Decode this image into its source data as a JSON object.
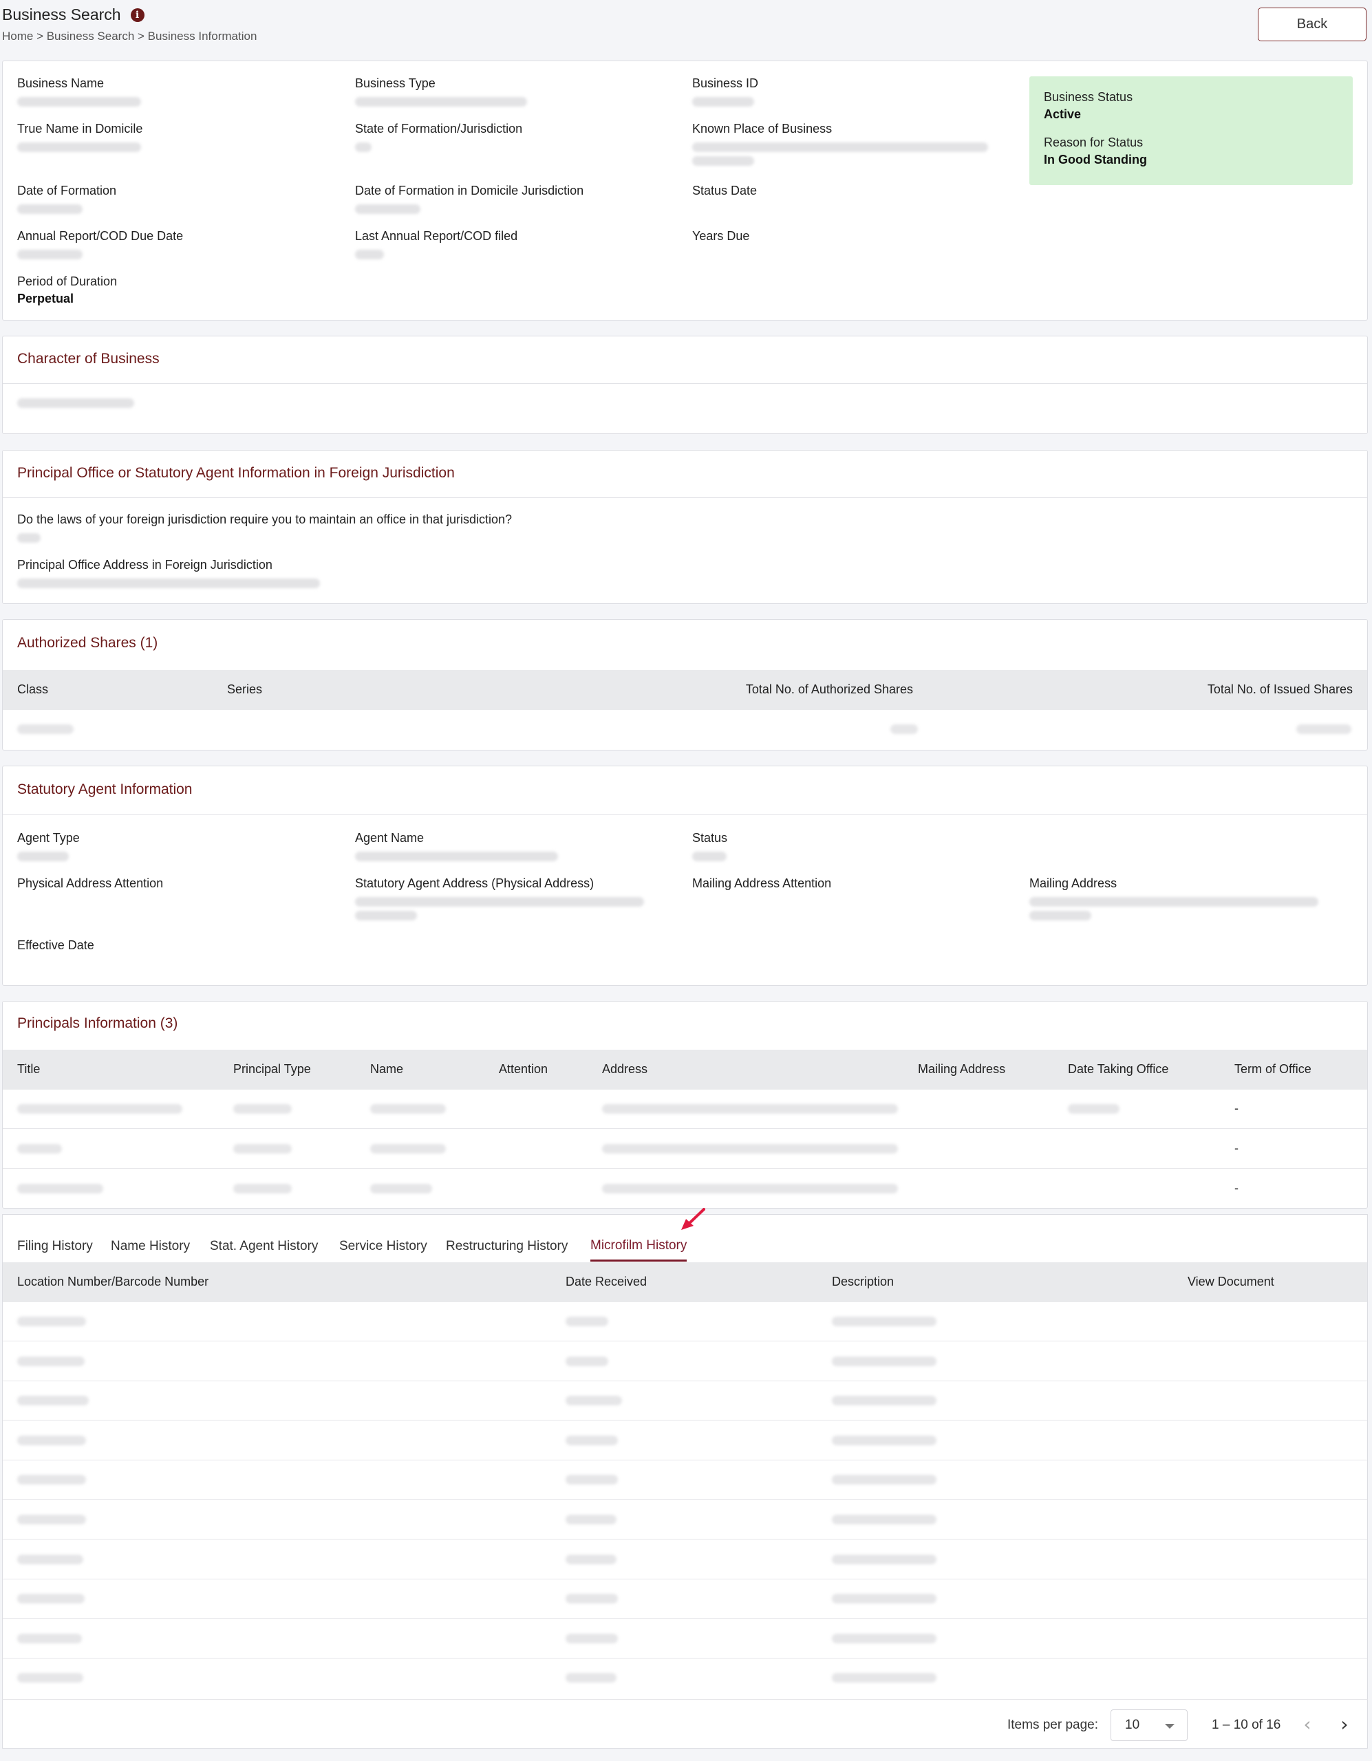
{
  "header": {
    "title": "Business Search",
    "breadcrumb": "Home > Business Search > Business Information",
    "back_label": "Back"
  },
  "details": {
    "business_name_label": "Business Name",
    "business_type_label": "Business Type",
    "business_id_label": "Business ID",
    "true_name_label": "True Name in Domicile",
    "state_formation_label": "State of Formation/Jurisdiction",
    "known_place_label": "Known Place of Business",
    "date_formation_label": "Date of Formation",
    "date_formation_domicile_label": "Date of Formation in Domicile Jurisdiction",
    "status_date_label": "Status Date",
    "annual_report_due_label": "Annual Report/COD Due Date",
    "last_annual_report_label": "Last Annual Report/COD filed",
    "years_due_label": "Years Due",
    "period_duration_label": "Period of Duration",
    "period_duration_value": "Perpetual",
    "status_label": "Business Status",
    "status_value": "Active",
    "reason_label": "Reason for Status",
    "reason_value": "In Good Standing"
  },
  "character": {
    "title": "Character of Business"
  },
  "principal_office": {
    "title": "Principal Office or Statutory Agent Information in Foreign Jurisdiction",
    "question_label": "Do the laws of your foreign jurisdiction require you to maintain an office in that jurisdiction?",
    "address_label": "Principal Office Address in Foreign Jurisdiction"
  },
  "shares": {
    "title": "Authorized Shares (1)",
    "columns": [
      "Class",
      "Series",
      "Total No. of Authorized Shares",
      "Total No. of Issued Shares"
    ]
  },
  "agent": {
    "title": "Statutory Agent Information",
    "agent_type_label": "Agent Type",
    "agent_name_label": "Agent Name",
    "status_label": "Status",
    "physical_attention_label": "Physical Address Attention",
    "physical_address_label": "Statutory Agent Address (Physical Address)",
    "mailing_attention_label": "Mailing Address Attention",
    "mailing_address_label": "Mailing Address",
    "effective_date_label": "Effective Date"
  },
  "principals": {
    "title": "Principals Information (3)",
    "columns": [
      "Title",
      "Principal Type",
      "Name",
      "Attention",
      "Address",
      "Mailing Address",
      "Date Taking Office",
      "Term of Office"
    ],
    "term_values": [
      "-",
      "-",
      "-"
    ]
  },
  "history_tabs": [
    "Filing History",
    "Name History",
    "Stat. Agent History",
    "Service History",
    "Restructuring History",
    "Microfilm History"
  ],
  "microfilm": {
    "columns": [
      "Location Number/Barcode Number",
      "Date Received",
      "Description",
      "View Document"
    ]
  },
  "pagination": {
    "items_per_page_label": "Items per page:",
    "items_per_page_value": "10",
    "range": "1 – 10 of 16",
    "prev_icon": "‹",
    "next_icon": "›"
  },
  "colors": {
    "accent": "#6b1a1a",
    "status_bg": "#d6f2d6"
  }
}
